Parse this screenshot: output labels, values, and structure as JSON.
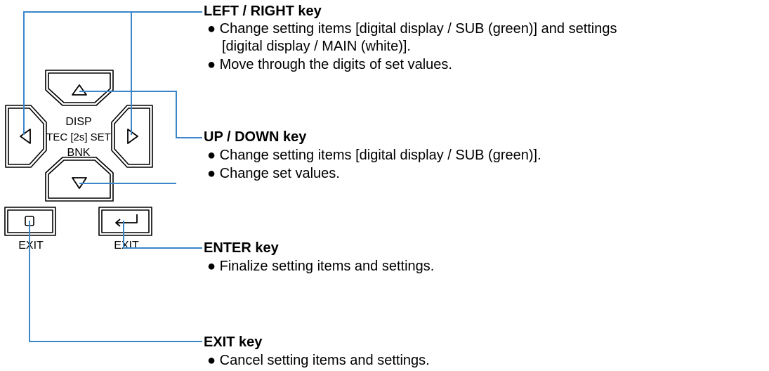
{
  "keypad": {
    "center_line1": "DISP",
    "center_line2": "TEC [2s] SET",
    "center_line3": "BNK",
    "exit_caption": "EXIT",
    "enter_caption": "EXIT"
  },
  "callouts": {
    "left_right": {
      "title": "LEFT / RIGHT key",
      "bullet1_line1": "Change setting items [digital display / SUB (green)] and settings",
      "bullet1_line2": "[digital display / MAIN (white)].",
      "bullet2": "Move through the digits of set values."
    },
    "up_down": {
      "title": "UP / DOWN key",
      "bullet1": "Change setting items [digital display / SUB (green)].",
      "bullet2": "Change set values."
    },
    "enter": {
      "title": "ENTER key",
      "bullet1": "Finalize setting items and settings."
    },
    "exit": {
      "title": "EXIT key",
      "bullet1": "Cancel setting items and settings."
    }
  },
  "colors": {
    "leader_line": "#3a86c8",
    "key_outline": "#000000"
  }
}
